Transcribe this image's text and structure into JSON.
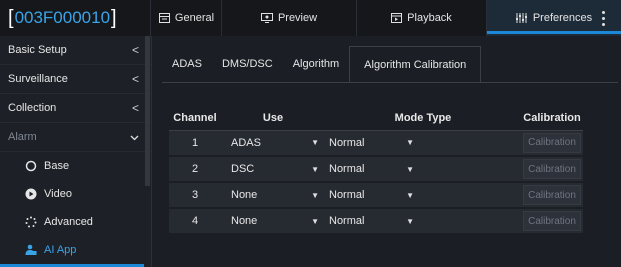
{
  "device": {
    "id": "003F000010"
  },
  "top_tabs": [
    {
      "label": "General",
      "icon": "general-icon"
    },
    {
      "label": "Preview",
      "icon": "preview-icon"
    },
    {
      "label": "Playback",
      "icon": "playback-icon"
    },
    {
      "label": "Preferences",
      "icon": "preferences-icon",
      "active": true
    }
  ],
  "sidebar": {
    "items": [
      {
        "label": "Basic Setup",
        "chevron": "<"
      },
      {
        "label": "Surveillance",
        "chevron": "<"
      },
      {
        "label": "Collection",
        "chevron": "<"
      },
      {
        "label": "Alarm",
        "chevron": "v",
        "expanded": true
      }
    ],
    "sub_items": [
      {
        "label": "Base",
        "icon": "circle-icon"
      },
      {
        "label": "Video",
        "icon": "video-icon"
      },
      {
        "label": "Advanced",
        "icon": "advanced-icon"
      },
      {
        "label": "AI App",
        "icon": "ai-app-icon",
        "active": true
      }
    ]
  },
  "sub_tabs": [
    {
      "label": "ADAS"
    },
    {
      "label": "DMS/DSC"
    },
    {
      "label": "Algorithm"
    },
    {
      "label": "Algorithm Calibration",
      "active": true
    }
  ],
  "table": {
    "headers": {
      "channel": "Channel",
      "use": "Use",
      "mode": "Mode Type",
      "calibration": "Calibration"
    },
    "rows": [
      {
        "channel": "1",
        "use": "ADAS",
        "mode": "Normal",
        "calibration": "Calibration"
      },
      {
        "channel": "2",
        "use": "DSC",
        "mode": "Normal",
        "calibration": "Calibration"
      },
      {
        "channel": "3",
        "use": "None",
        "mode": "Normal",
        "calibration": "Calibration"
      },
      {
        "channel": "4",
        "use": "None",
        "mode": "Normal",
        "calibration": "Calibration"
      }
    ]
  },
  "colors": {
    "accent": "#1e88d8",
    "device_id": "#3aa4e8",
    "background": "#1b1e24"
  }
}
